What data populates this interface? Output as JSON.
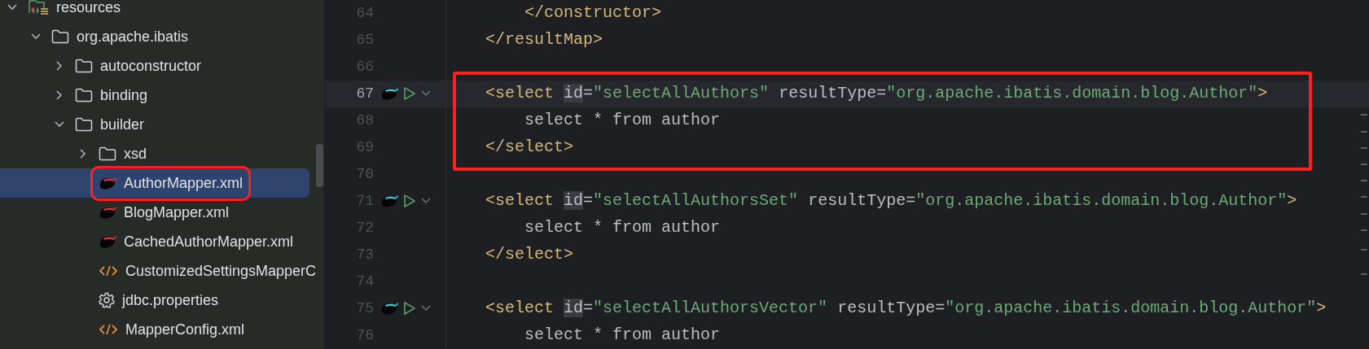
{
  "project_tree": [
    {
      "label": "resources",
      "kind": "resources",
      "expanded": true,
      "selected": false,
      "boxed": false,
      "children": [
        {
          "label": "org.apache.ibatis",
          "kind": "folder",
          "expanded": true,
          "selected": false,
          "boxed": false,
          "children": [
            {
              "label": "autoconstructor",
              "kind": "folder",
              "expanded": false,
              "selected": false,
              "boxed": false
            },
            {
              "label": "binding",
              "kind": "folder",
              "expanded": false,
              "selected": false,
              "boxed": false
            },
            {
              "label": "builder",
              "kind": "folder",
              "expanded": true,
              "selected": false,
              "boxed": false,
              "children": [
                {
                  "label": "xsd",
                  "kind": "folder",
                  "expanded": false,
                  "selected": false,
                  "boxed": false
                },
                {
                  "label": "AuthorMapper.xml",
                  "kind": "mybatis",
                  "selected": true,
                  "boxed": true
                },
                {
                  "label": "BlogMapper.xml",
                  "kind": "mybatis",
                  "selected": false,
                  "boxed": false
                },
                {
                  "label": "CachedAuthorMapper.xml",
                  "kind": "mybatis",
                  "selected": false,
                  "boxed": false
                },
                {
                  "label": "CustomizedSettingsMapperC",
                  "kind": "xml",
                  "selected": false,
                  "boxed": false
                },
                {
                  "label": "jdbc.properties",
                  "kind": "properties",
                  "selected": false,
                  "boxed": false
                },
                {
                  "label": "MapperConfig.xml",
                  "kind": "xml",
                  "selected": false,
                  "boxed": false
                }
              ]
            }
          ]
        }
      ]
    }
  ],
  "editor": {
    "lines": [
      {
        "number": "64",
        "current": false,
        "runnable": false,
        "boxed": false,
        "tokens": [
          {
            "kind": "tag",
            "text": "        </constructor>"
          }
        ]
      },
      {
        "number": "65",
        "current": false,
        "runnable": false,
        "boxed": false,
        "tokens": [
          {
            "kind": "tag",
            "text": "    </resultMap>"
          }
        ]
      },
      {
        "number": "66",
        "current": false,
        "runnable": false,
        "boxed": false
      },
      {
        "number": "67",
        "current": true,
        "runnable": true,
        "boxed": true,
        "tokens": [
          {
            "kind": "tag",
            "text": "    <select "
          },
          {
            "kind": "occurrence",
            "text": "id"
          },
          {
            "kind": "attr",
            "text": "="
          },
          {
            "kind": "value",
            "text": "\"selectAllAuthors\""
          },
          {
            "kind": "attr",
            "text": " resultType="
          },
          {
            "kind": "value",
            "text": "\"org.apache.ibatis.domain.blog.Author\""
          },
          {
            "kind": "tag",
            "text": ">"
          }
        ]
      },
      {
        "number": "68",
        "current": false,
        "runnable": false,
        "boxed": true,
        "tokens": [
          {
            "kind": "text",
            "text": "        select * from author"
          }
        ]
      },
      {
        "number": "69",
        "current": false,
        "runnable": false,
        "boxed": true,
        "tokens": [
          {
            "kind": "tag",
            "text": "    </select>"
          }
        ]
      },
      {
        "number": "70",
        "current": false,
        "runnable": false,
        "boxed": false
      },
      {
        "number": "71",
        "current": false,
        "runnable": true,
        "boxed": false,
        "tokens": [
          {
            "kind": "tag",
            "text": "    <select "
          },
          {
            "kind": "occurrence",
            "text": "id"
          },
          {
            "kind": "attr",
            "text": "="
          },
          {
            "kind": "value",
            "text": "\"selectAllAuthorsSet\""
          },
          {
            "kind": "attr",
            "text": " resultType="
          },
          {
            "kind": "value",
            "text": "\"org.apache.ibatis.domain.blog.Author\""
          },
          {
            "kind": "tag",
            "text": ">"
          }
        ]
      },
      {
        "number": "72",
        "current": false,
        "runnable": false,
        "boxed": false,
        "tokens": [
          {
            "kind": "text",
            "text": "        select * from author"
          }
        ]
      },
      {
        "number": "73",
        "current": false,
        "runnable": false,
        "boxed": false,
        "tokens": [
          {
            "kind": "tag",
            "text": "    </select>"
          }
        ]
      },
      {
        "number": "74",
        "current": false,
        "runnable": false,
        "boxed": false
      },
      {
        "number": "75",
        "current": false,
        "runnable": true,
        "boxed": false,
        "tokens": [
          {
            "kind": "tag",
            "text": "    <select "
          },
          {
            "kind": "occurrence",
            "text": "id"
          },
          {
            "kind": "attr",
            "text": "="
          },
          {
            "kind": "value",
            "text": "\"selectAllAuthorsVector\""
          },
          {
            "kind": "attr",
            "text": " resultType="
          },
          {
            "kind": "value",
            "text": "\"org.apache.ibatis.domain.blog.Author\""
          },
          {
            "kind": "tag",
            "text": ">"
          }
        ]
      },
      {
        "number": "76",
        "current": false,
        "runnable": false,
        "boxed": false,
        "tokens": [
          {
            "kind": "text",
            "text": "        select * from author"
          }
        ]
      }
    ]
  }
}
